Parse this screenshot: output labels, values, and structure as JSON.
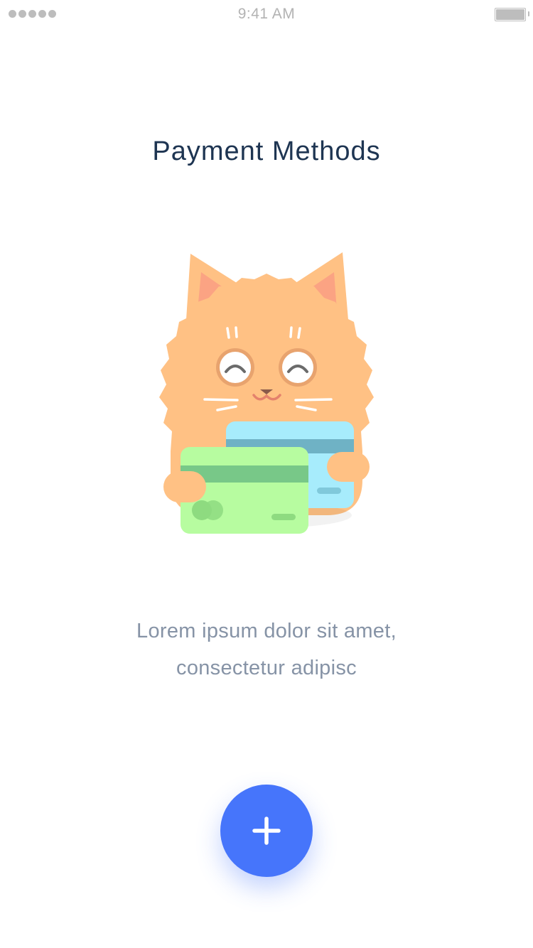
{
  "status_bar": {
    "time": "9:41 AM",
    "signal_icon": "signal-dots-icon",
    "battery_icon": "battery-icon"
  },
  "page": {
    "title": "Payment Methods",
    "description_line1": "Lorem ipsum dolor sit amet,",
    "description_line2": "consectetur adipisc"
  },
  "illustration": {
    "icon": "cat-holding-cards-icon"
  },
  "add_button": {
    "icon": "plus-icon",
    "color": "#4675fb"
  },
  "colors": {
    "title": "#1e3552",
    "description": "#8693a6",
    "accent": "#4675fb"
  }
}
